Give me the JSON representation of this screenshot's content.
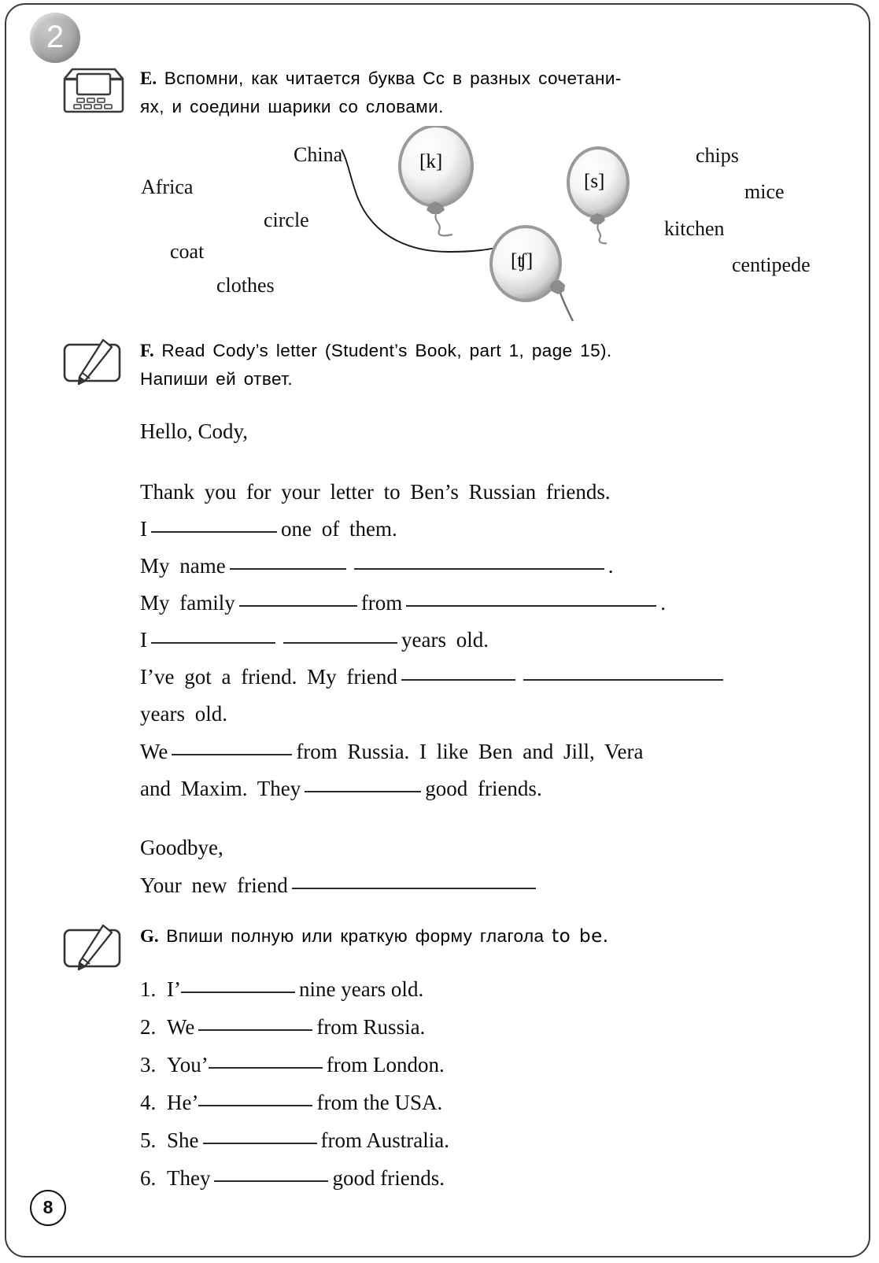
{
  "chapter": {
    "number": "2"
  },
  "page": {
    "number": "8"
  },
  "task_e": {
    "letter": "E.",
    "icon": "cd-player-icon",
    "text_line1": "Вспомни, как читается буква Cc в разных сочетани-",
    "text_line2": "ях, и соедини шарики со словами.",
    "balloons": [
      {
        "label": "[k]",
        "name": "balloon-k"
      },
      {
        "label": "[s]",
        "name": "balloon-s"
      },
      {
        "label": "[ʧ]",
        "name": "balloon-ch"
      }
    ],
    "words_left": [
      "China",
      "Africa",
      "circle",
      "coat",
      "clothes"
    ],
    "words_right": [
      "chips",
      "mice",
      "kitchen",
      "centipede"
    ]
  },
  "task_f": {
    "letter": "F.",
    "icon": "pencil-icon",
    "text_line1": "Read Cody’s letter (Student’s Book, part 1, page 15).",
    "text_line2": "Напиши ей ответ.",
    "letter_body": {
      "greeting": "Hello,  Cody,",
      "line_thanks": "Thank  you  for  your  letter  to  Ben’s  Russian  friends.",
      "line_i_one": {
        "pre": "I",
        "post": "one  of  them."
      },
      "line_my_name": {
        "pre": "My  name",
        "post": "."
      },
      "line_my_family": {
        "pre": "My  family",
        "mid": "from",
        "post": "."
      },
      "line_i_years": {
        "pre": "I",
        "post": "years  old."
      },
      "line_ive_got": {
        "pre": "I’ve  got  a  friend.  My  friend"
      },
      "line_years_old": "years  old.",
      "line_we_from": {
        "pre": "We",
        "post": "from  Russia.  I  like  Ben  and  Jill,  Vera"
      },
      "line_and_maxim": {
        "pre": "and  Maxim.  They",
        "post": "good  friends."
      },
      "closing": "Goodbye,",
      "signature": "Your  new  friend"
    }
  },
  "task_g": {
    "letter": "G.",
    "icon": "pencil-icon",
    "text": "Впиши полную или краткую форму глагола ",
    "verb": "to be.",
    "items": [
      {
        "num": "1.",
        "pre": "I’",
        "post": "nine  years  old.",
        "attached": true
      },
      {
        "num": "2.",
        "pre": "We",
        "post": "from  Russia.",
        "attached": false
      },
      {
        "num": "3.",
        "pre": "You’",
        "post": "from  London.",
        "attached": true
      },
      {
        "num": "4.",
        "pre": "He’",
        "post": "from  the  USA.",
        "attached": true
      },
      {
        "num": "5.",
        "pre": "She",
        "post": "from  Australia.",
        "attached": false
      },
      {
        "num": "6.",
        "pre": "They",
        "post": "good  friends.",
        "attached": false
      }
    ]
  }
}
